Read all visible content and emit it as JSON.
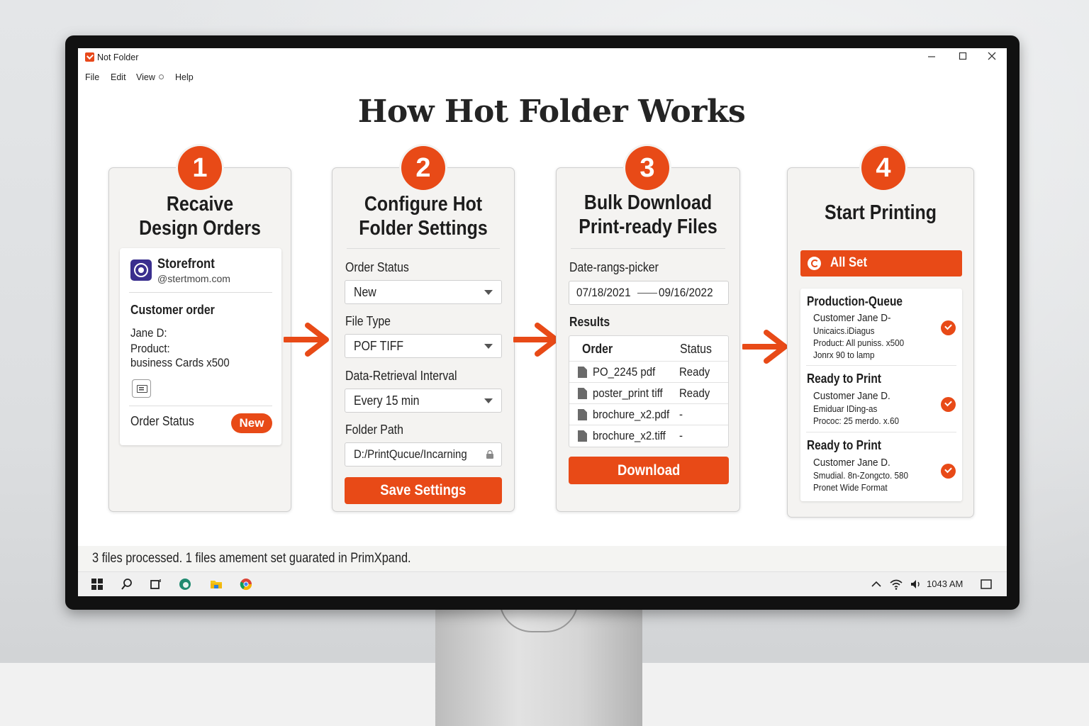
{
  "window": {
    "title": "Not Folder",
    "minimize_icon": "minimize-icon",
    "maximize_icon": "maximize-icon",
    "close_icon": "close-icon"
  },
  "menu": [
    "File",
    "Edit",
    "View",
    "Help"
  ],
  "heading": "How Hot Folder Works",
  "steps": [
    {
      "number": "1",
      "title_lines": [
        "Recaive",
        "Design Orders"
      ],
      "store_name": "Storefront",
      "store_handle": "@stertmom.com",
      "section": "Customer order",
      "details": [
        "Jane D:",
        "Product:",
        "business Cards x500"
      ],
      "status_label": "Order Status",
      "status_badge": "New"
    },
    {
      "number": "2",
      "title_lines": [
        "Configure Hot",
        "Folder Settings"
      ],
      "fields": [
        {
          "label": "Order Status",
          "value": "New"
        },
        {
          "label": "File Type",
          "value": "POF TIFF"
        },
        {
          "label": "Data-Retrieval Interval",
          "value": "Every 15 min"
        }
      ],
      "path_label": "Folder Path",
      "path_value": "D:/PrintQucue/Incarning",
      "button": "Save Settings"
    },
    {
      "number": "3",
      "title_lines": [
        "Bulk Download",
        "Print-ready Files"
      ],
      "date_label": "Date-rangs-picker",
      "date_from": "07/18/2021",
      "date_to": "09/16/2022",
      "results_label": "Results",
      "columns": [
        "Order",
        "Status"
      ],
      "rows": [
        {
          "name": "PO_2245 pdf",
          "status": "Ready"
        },
        {
          "name": "poster_print tiff",
          "status": "Ready"
        },
        {
          "name": "brochure_x2.pdf",
          "status": "-"
        },
        {
          "name": "brochure_x2.tiff",
          "status": "-"
        }
      ],
      "button": "Download"
    },
    {
      "number": "4",
      "title_lines": [
        "Start Printing"
      ],
      "banner": "All Set",
      "queue": [
        {
          "title": "Production-Queue",
          "lines": [
            "Customer Jane D-",
            "Unicaics.iDiagus",
            "Product: All puniss. x500",
            "Jonrx 90 to lamp"
          ]
        },
        {
          "title": "Ready to Print",
          "lines": [
            "Customer Jane D.",
            "Emiduar IDing-as",
            "Prococ: 25 merdo. x.60"
          ]
        },
        {
          "title": "Ready to Print",
          "lines": [
            "Customer Jane D.",
            "Smudial. 8n-Zongcto. 580",
            "Pronet Wide Format"
          ]
        }
      ]
    }
  ],
  "status_bar": "3 files processed. 1 files amement set guarated in PrimXpand.",
  "taskbar": {
    "clock": "1043 AM",
    "icons": [
      "start-icon",
      "search-icon",
      "task-view-icon",
      "edge-icon",
      "file-explorer-icon",
      "chrome-icon"
    ]
  },
  "colors": {
    "accent": "#e84a17",
    "card_bg": "#f4f3f1",
    "store_logo": "#3a2f8e"
  }
}
